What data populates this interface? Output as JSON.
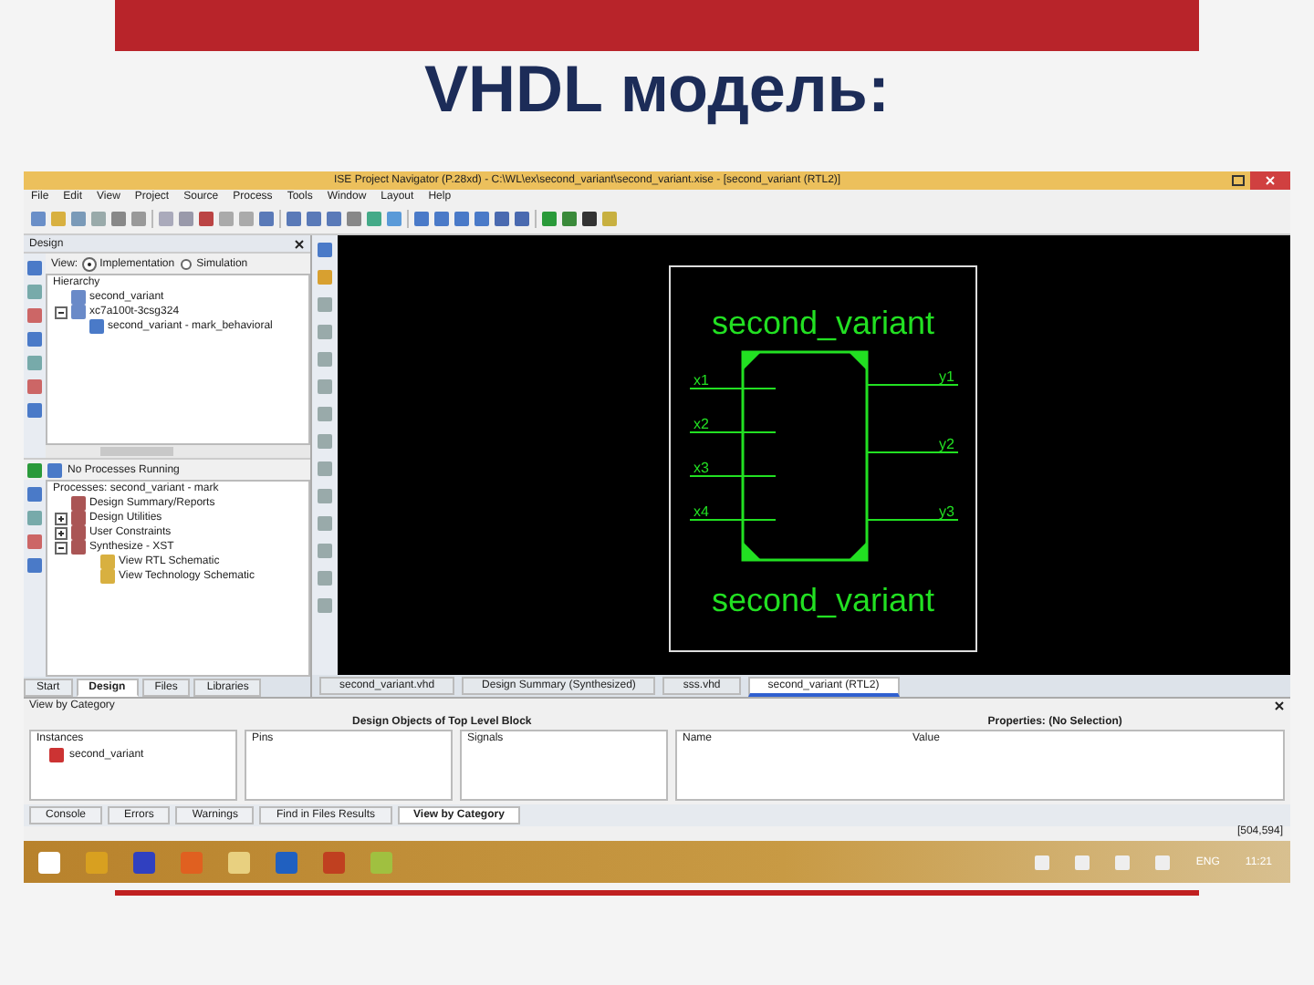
{
  "slide": {
    "title": "VHDL модель:"
  },
  "window": {
    "title": "ISE Project Navigator (P.28xd) - C:\\WL\\ex\\second_variant\\second_variant.xise - [second_variant (RTL2)]",
    "menu": [
      "File",
      "Edit",
      "View",
      "Project",
      "Source",
      "Process",
      "Tools",
      "Window",
      "Layout",
      "Help"
    ]
  },
  "design_panel": {
    "title": "Design",
    "view_label": "View:",
    "view_options": [
      {
        "label": "Implementation",
        "selected": true
      },
      {
        "label": "Simulation",
        "selected": false
      }
    ],
    "hierarchy_label": "Hierarchy",
    "hierarchy": [
      {
        "label": "second_variant"
      },
      {
        "label": "xc7a100t-3csg324",
        "children": [
          {
            "label": "second_variant - mark_behavioral"
          }
        ]
      }
    ]
  },
  "processes": {
    "status": "No Processes Running",
    "header": "Processes: second_variant - mark",
    "items": [
      {
        "label": "Design Summary/Reports",
        "expandable": false
      },
      {
        "label": "Design Utilities",
        "expandable": true
      },
      {
        "label": "User Constraints",
        "expandable": true
      },
      {
        "label": "Synthesize - XST",
        "expandable": true,
        "children": [
          {
            "label": "View RTL Schematic",
            "expandable": false
          },
          {
            "label": "View Technology Schematic",
            "expandable": false
          }
        ]
      }
    ]
  },
  "left_tabs": [
    {
      "label": "Start",
      "selected": false
    },
    {
      "label": "Design",
      "selected": true
    },
    {
      "label": "Files",
      "selected": false
    },
    {
      "label": "Libraries",
      "selected": false
    }
  ],
  "schematic": {
    "title_top": "second_variant",
    "title_bottom": "second_variant",
    "inputs": [
      "x1",
      "x2",
      "x3",
      "x4"
    ],
    "outputs": [
      "y1",
      "y2",
      "y3"
    ]
  },
  "doc_tabs": [
    {
      "label": "second_variant.vhd",
      "selected": false
    },
    {
      "label": "Design Summary (Synthesized)",
      "selected": false
    },
    {
      "label": "sss.vhd",
      "selected": false
    },
    {
      "label": "second_variant (RTL2)",
      "selected": true
    }
  ],
  "bottom_panel": {
    "view_label": "View by Category",
    "objects_title": "Design Objects of Top Level Block",
    "properties_title": "Properties: (No Selection)",
    "columns": [
      {
        "header": "Instances",
        "items": [
          "second_variant"
        ]
      },
      {
        "header": "Pins"
      },
      {
        "header": "Signals"
      }
    ],
    "property_columns": [
      "Name",
      "Value"
    ]
  },
  "console_tabs": [
    {
      "label": "Console",
      "selected": false
    },
    {
      "label": "Errors",
      "selected": false
    },
    {
      "label": "Warnings",
      "selected": false
    },
    {
      "label": "Find in Files Results",
      "selected": false
    },
    {
      "label": "View by Category",
      "selected": true
    }
  ],
  "status_bar": "[504,594]",
  "taskbar": {
    "language": "ENG",
    "time": "11:21"
  }
}
